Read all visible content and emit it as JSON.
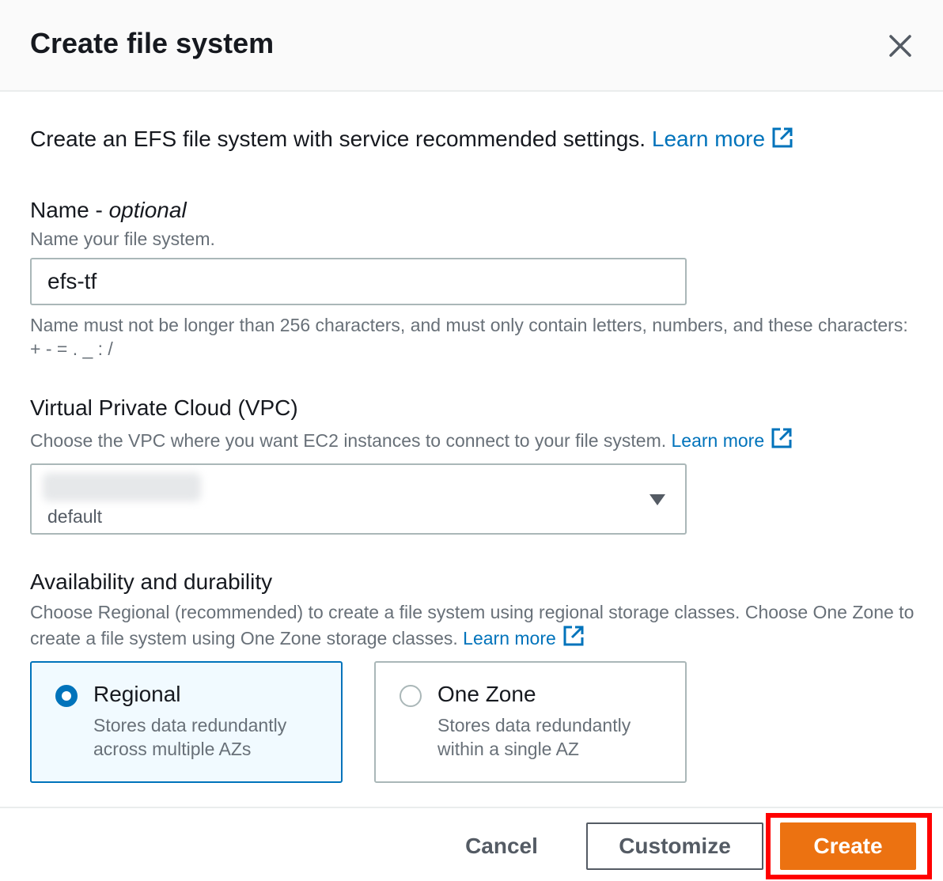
{
  "modal": {
    "title": "Create file system",
    "close_icon": "close-icon"
  },
  "intro": {
    "text": "Create an EFS file system with service recommended settings.",
    "link": "Learn more",
    "link_icon": "external-link-icon"
  },
  "name_field": {
    "label": "Name -",
    "label_suffix": "optional",
    "description": "Name your file system.",
    "value": "efs-tf",
    "constraint": "Name must not be longer than 256 characters, and must only contain letters, numbers, and these characters: + - = . _ : /"
  },
  "vpc_field": {
    "label": "Virtual Private Cloud (VPC)",
    "description": "Choose the VPC where you want EC2 instances to connect to your file system.",
    "link": "Learn more",
    "selected_sublabel": "default",
    "caret_icon": "caret-down-icon"
  },
  "availability": {
    "label": "Availability and durability",
    "description": "Choose Regional (recommended) to create a file system using regional storage classes. Choose One Zone to create a file system using One Zone storage classes.",
    "link": "Learn more",
    "options": [
      {
        "title": "Regional",
        "description": "Stores data redundantly across multiple AZs",
        "selected": true
      },
      {
        "title": "One Zone",
        "description": "Stores data redundantly within a single AZ",
        "selected": false
      }
    ]
  },
  "footer": {
    "cancel_label": "Cancel",
    "customize_label": "Customize",
    "create_label": "Create"
  },
  "colors": {
    "link": "#0073bb",
    "primary_button": "#ec7211",
    "highlight": "#ff0000"
  }
}
